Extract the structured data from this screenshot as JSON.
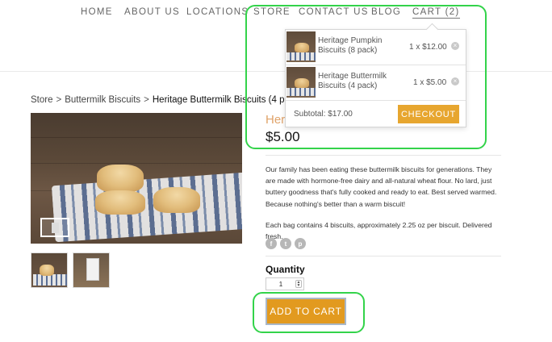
{
  "nav": {
    "items": [
      "HOME",
      "ABOUT US",
      "LOCATIONS",
      "STORE",
      "CONTACT US",
      "BLOG",
      "CART (2)"
    ]
  },
  "breadcrumb": {
    "items": [
      "Store",
      "Buttermilk Biscuits",
      "Heritage Buttermilk Biscuits (4 pack)"
    ],
    "separator": ">"
  },
  "product": {
    "title_peek": "Heri",
    "price": "$5.00",
    "description": [
      "Our family has been eating these buttermilk biscuits for generations. They are made with hormone-free dairy and all-natural wheat flour. No lard, just buttery goodness that's fully cooked and ready to eat. Best served warmed. Because nothing's better than a warm biscuit!",
      "Each bag contains 4 biscuits, approximately 2.25 oz per biscuit. Delivered fresh."
    ],
    "social_icons": [
      "facebook-icon",
      "twitter-icon",
      "pinterest-icon"
    ],
    "social_glyphs": [
      "f",
      "t",
      "p"
    ],
    "quantity_label": "Quantity",
    "quantity_value": "1",
    "add_to_cart_label": "ADD TO CART"
  },
  "cart_dropdown": {
    "items": [
      {
        "name": "Heritage Pumpkin Biscuits (8 pack)",
        "qty_price": "1 x $12.00",
        "remove": "×"
      },
      {
        "name": "Heritage Buttermilk Biscuits (4 pack)",
        "qty_price": "1 x $5.00",
        "remove": "×"
      }
    ],
    "subtotal": "Subtotal: $17.00",
    "checkout_label": "CHECKOUT"
  },
  "colors": {
    "accent_orange": "#e29a1f",
    "highlight_green": "#33d34a",
    "title_peek": "#e0a36a"
  }
}
